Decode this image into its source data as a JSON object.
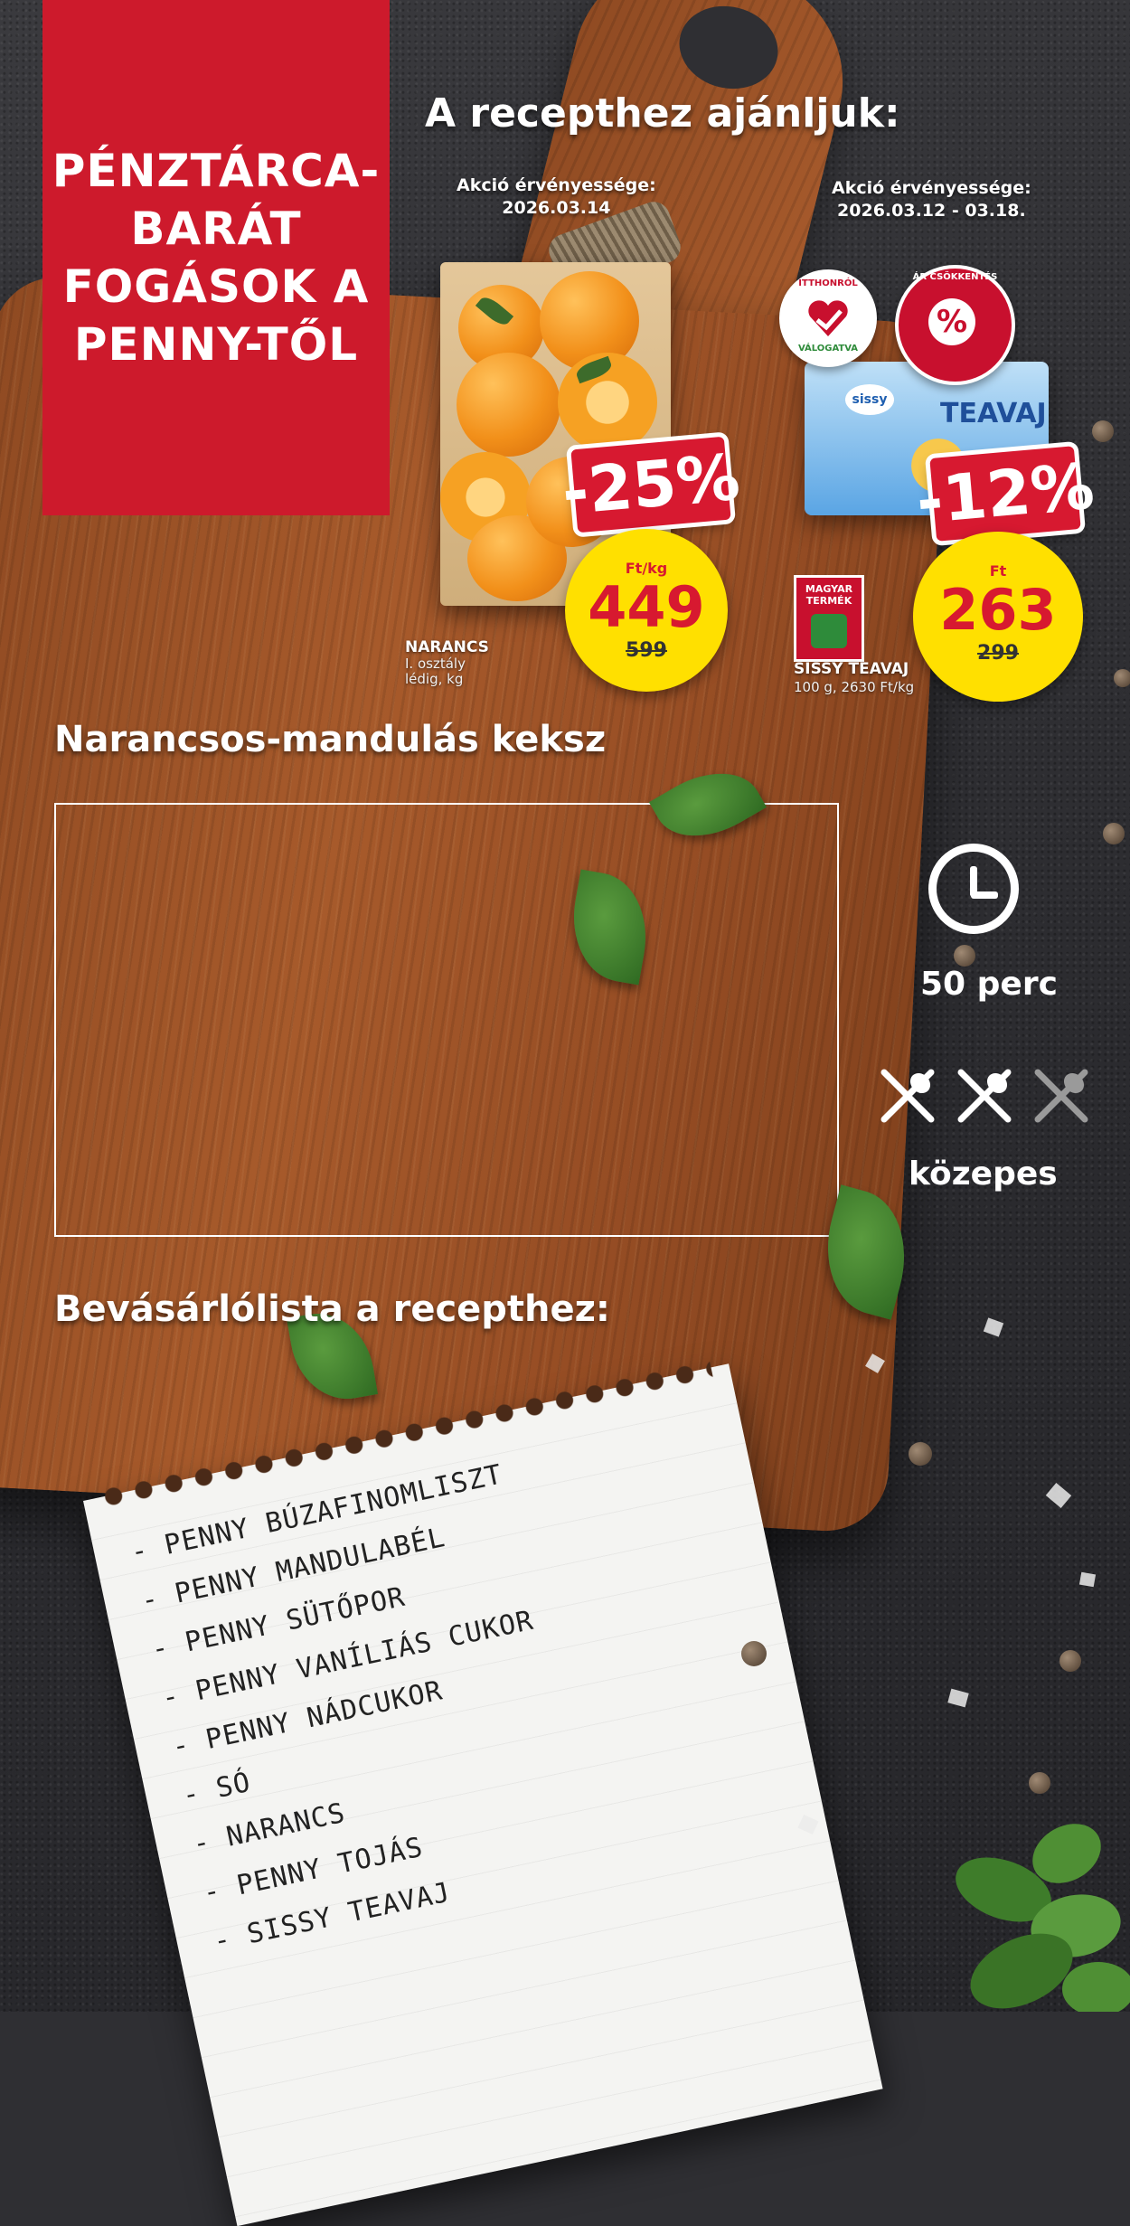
{
  "panel": {
    "lines": [
      "PÉNZTÁRCA-",
      "BARÁT",
      "FOGÁSOK A",
      "PENNY-TŐL"
    ]
  },
  "recommend": {
    "title": "A recepthez ajánljuk:",
    "validity_left_label": "Akció érvényessége:",
    "validity_left_date": "2026.03.14",
    "validity_right_label": "Akció érvényessége:",
    "validity_right_date": "2026.03.12 - 03.18."
  },
  "products": [
    {
      "name": "NARANCS",
      "desc_line1": "I. osztály",
      "desc_line2": "lédig, kg",
      "discount": "-25%",
      "unit": "Ft/kg",
      "price": "449",
      "old_price": "599"
    },
    {
      "name": "SISSY TEAVAJ",
      "desc_line1": "100 g, 2630 Ft/kg",
      "discount": "-12%",
      "unit": "Ft",
      "price": "263",
      "old_price": "299",
      "pack_brand": "sissy",
      "pack_word": "TEAVAJ",
      "badge_hu_top": "ITTHONRÓL",
      "badge_hu_bottom": "VÁLOGATVA",
      "badge_ar_text": "ÁR CSÖKKENTÉS",
      "badge_ar_pct": "%",
      "magyar_label": "MAGYAR TERMÉK"
    }
  ],
  "recipe": {
    "title": "Narancsos-mandulás keksz",
    "time": "50 perc",
    "difficulty": "közepes"
  },
  "shopping": {
    "title": "Bevásárlólista a recepthez:",
    "items": [
      "- PENNY BÚZAFINOMLISZT",
      "- PENNY MANDULABÉL",
      "- PENNY SÜTŐPOR",
      "- PENNY VANÍLIÁS CUKOR",
      "- PENNY NÁDCUKOR",
      "- SÓ",
      "- NARANCS",
      "- PENNY TOJÁS",
      "- SISSY TEAVAJ"
    ]
  },
  "colors": {
    "brand_red": "#cd1a2c",
    "price_yellow": "#ffe000",
    "discount_red": "#d71930"
  },
  "icons": [
    "clock-icon",
    "utensils-icon"
  ]
}
